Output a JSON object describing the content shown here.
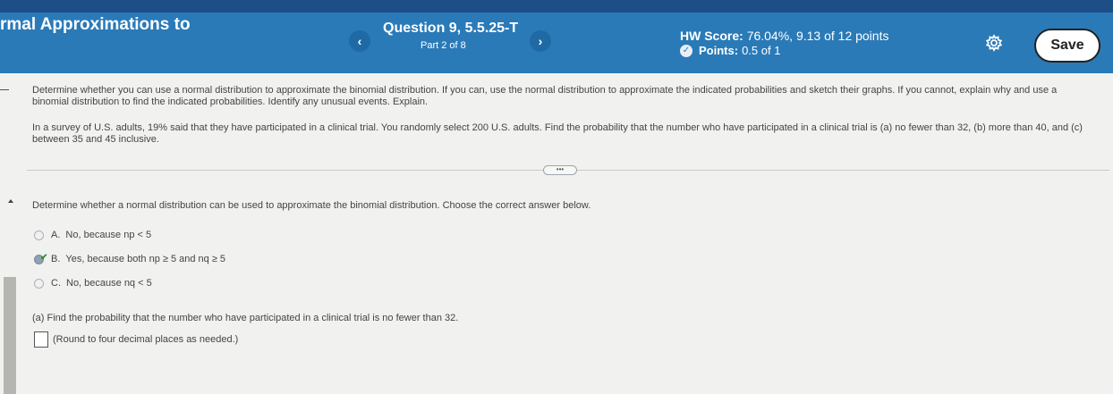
{
  "header": {
    "title": "rmal Approximations to",
    "question": "Question 9, 5.5.25-T",
    "part": "Part 2 of 8",
    "hw_score_label": "HW Score:",
    "hw_score_value": "76.04%, 9.13 of 12 points",
    "points_label": "Points:",
    "points_value": "0.5 of 1",
    "prev_glyph": "‹",
    "next_glyph": "›",
    "save_label": "Save",
    "colors": {
      "bar": "#2a7ab8",
      "top_strip": "#1d4f86"
    }
  },
  "problem": {
    "intro": "Determine whether you can use a normal distribution to approximate the binomial distribution. If you can, use the normal distribution to approximate the indicated probabilities and sketch their graphs. If you cannot, explain why and use a binomial distribution to find the indicated probabilities. Identify any unusual events. Explain.",
    "scenario": "In a survey of U.S. adults, 19% said that they have participated in a clinical trial. You randomly select 200 U.S. adults. Find the probability that the number who have participated in a clinical trial is (a) no fewer than 32, (b) more than 40, and (c) between 35 and 45 inclusive.",
    "more_label": "•••"
  },
  "question": {
    "prompt": "Determine whether a normal distribution can be used to approximate the binomial distribution. Choose the correct answer below.",
    "options": [
      {
        "letter": "A.",
        "text": "No, because np < 5",
        "selected": false
      },
      {
        "letter": "B.",
        "text": "Yes, because both np ≥ 5 and nq ≥ 5",
        "selected": true
      },
      {
        "letter": "C.",
        "text": "No, because nq < 5",
        "selected": false
      }
    ]
  },
  "part_a": {
    "prompt": "(a) Find the probability that the number who have participated in a clinical trial is no fewer than 32.",
    "input_value": "",
    "hint": "(Round to four decimal places as needed.)"
  }
}
